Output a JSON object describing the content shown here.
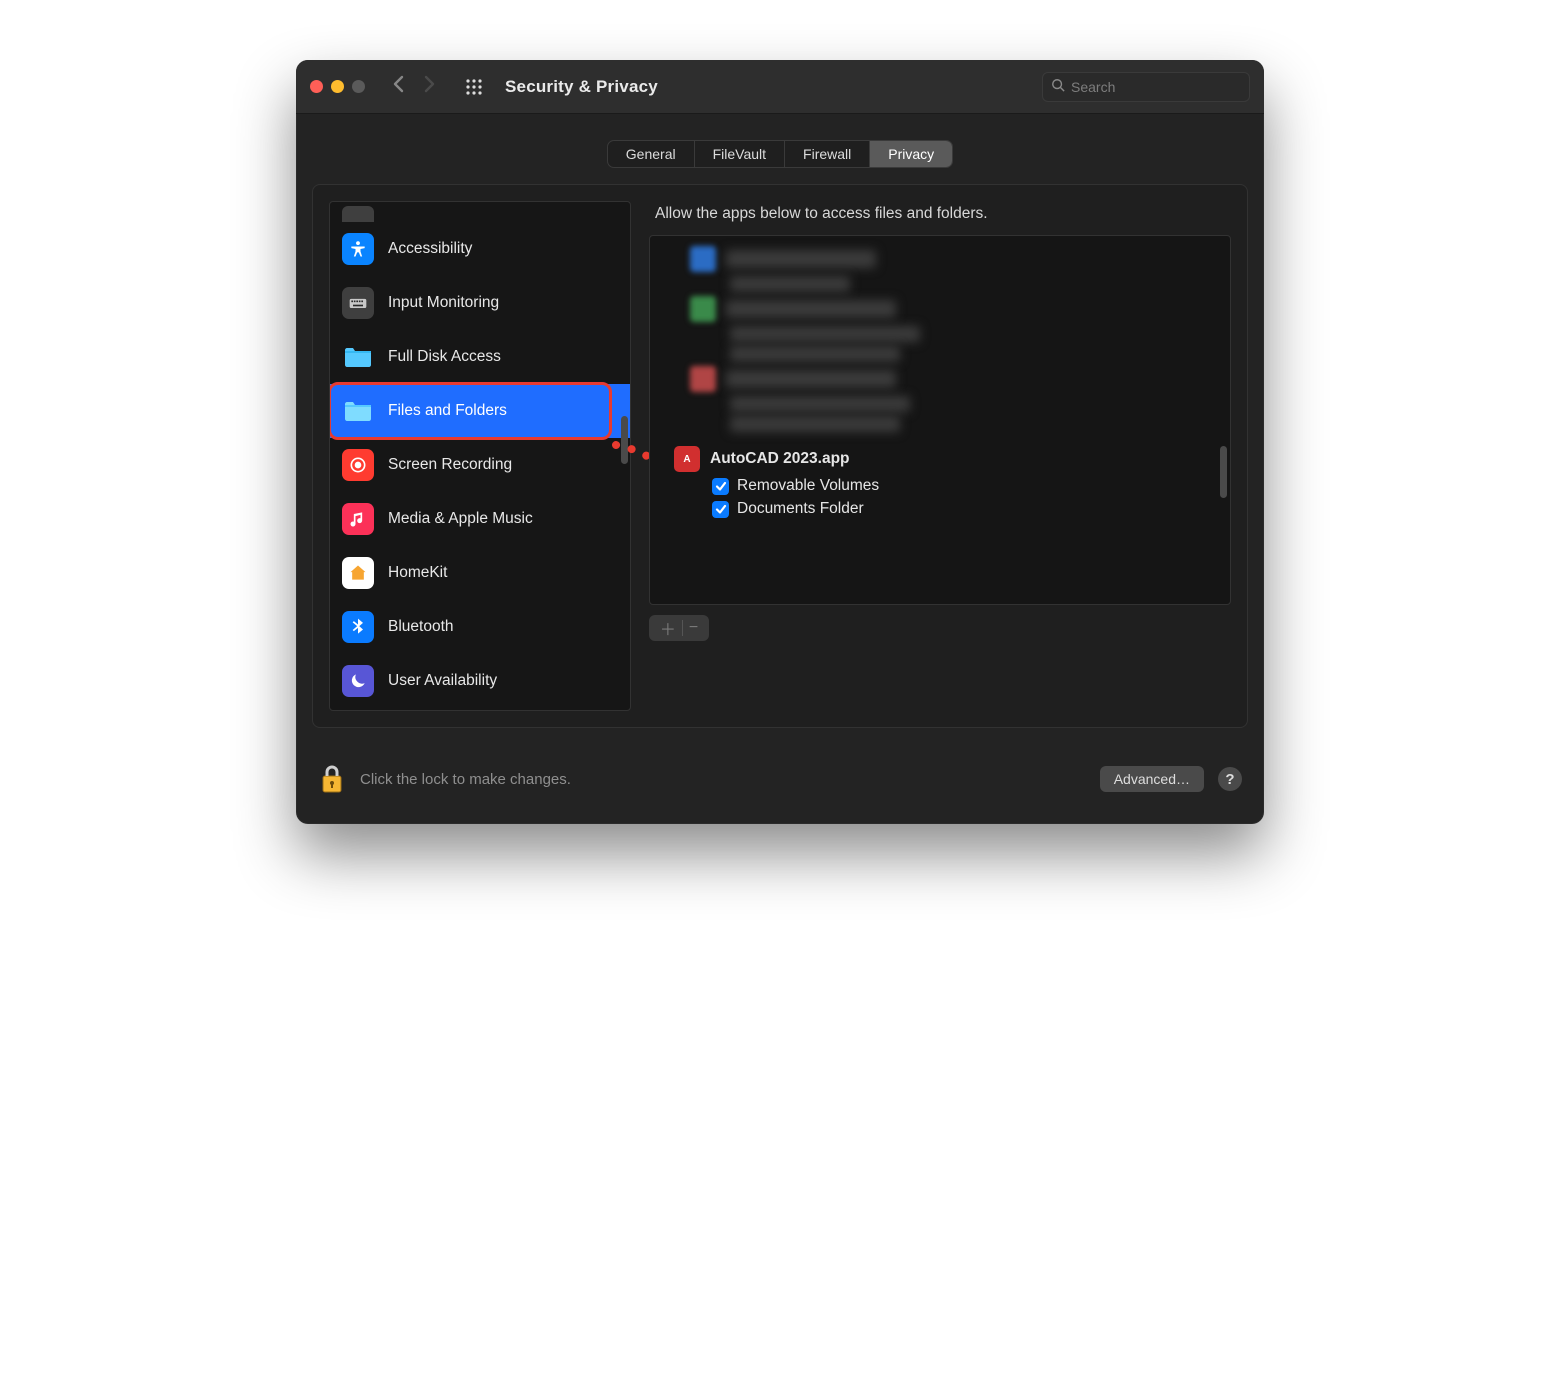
{
  "window": {
    "title": "Security & Privacy"
  },
  "search": {
    "placeholder": "Search"
  },
  "tabs": [
    {
      "label": "General",
      "active": false
    },
    {
      "label": "FileVault",
      "active": false
    },
    {
      "label": "Firewall",
      "active": false
    },
    {
      "label": "Privacy",
      "active": true
    }
  ],
  "sidebar_selected_index": 3,
  "sidebar": [
    {
      "label": "Accessibility"
    },
    {
      "label": "Input Monitoring"
    },
    {
      "label": "Full Disk Access"
    },
    {
      "label": "Files and Folders"
    },
    {
      "label": "Screen Recording"
    },
    {
      "label": "Media & Apple Music"
    },
    {
      "label": "HomeKit"
    },
    {
      "label": "Bluetooth"
    },
    {
      "label": "User Availability"
    }
  ],
  "detail": {
    "header": "Allow the apps below to access files and folders.",
    "app": {
      "name": "AutoCAD 2023.app",
      "permissions": [
        {
          "label": "Removable Volumes",
          "checked": true
        },
        {
          "label": "Documents Folder",
          "checked": true
        }
      ]
    }
  },
  "footer": {
    "lock_text": "Click the lock to make changes.",
    "advanced": "Advanced…"
  },
  "annotations": {
    "highlighted_sidebar_item": "Files and Folders",
    "arrow_target": "AutoCAD 2023.app"
  }
}
